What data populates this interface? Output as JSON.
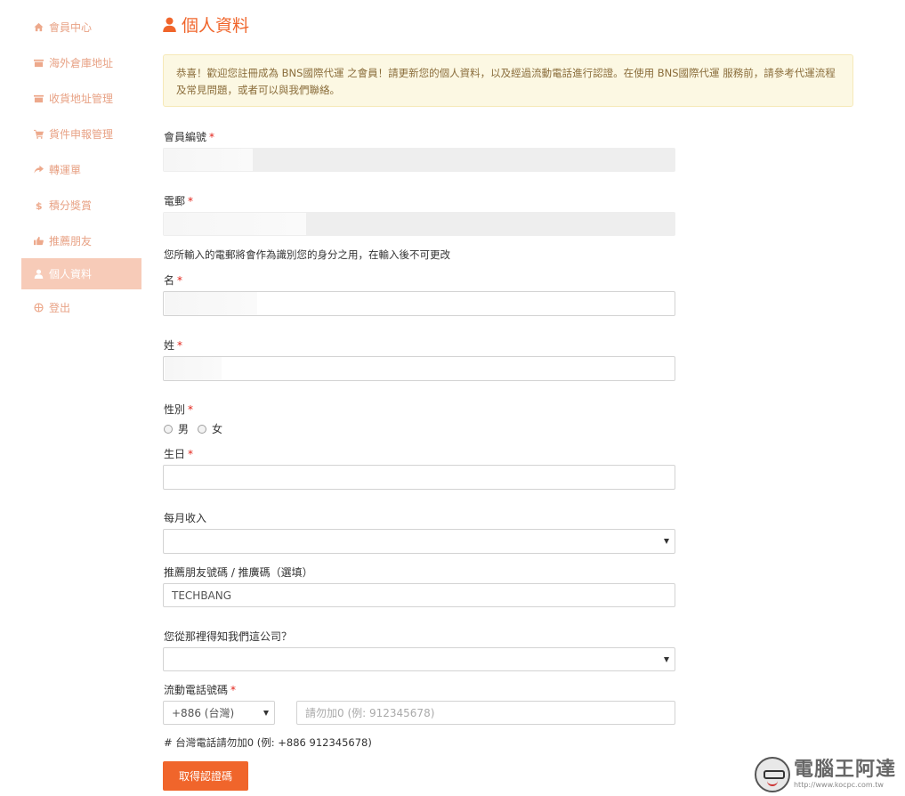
{
  "sidebar": {
    "items": [
      {
        "label": "會員中心",
        "icon": "home-icon"
      },
      {
        "label": "海外倉庫地址",
        "icon": "warehouse-icon"
      },
      {
        "label": "收貨地址管理",
        "icon": "address-icon"
      },
      {
        "label": "貨件申報管理",
        "icon": "cart-icon"
      },
      {
        "label": "轉運單",
        "icon": "share-arrow-icon"
      },
      {
        "label": "積分獎賞",
        "icon": "dollar-icon"
      },
      {
        "label": "推薦朋友",
        "icon": "thumbs-up-icon"
      },
      {
        "label": "個人資料",
        "icon": "user-icon",
        "active": true
      },
      {
        "label": "登出",
        "icon": "globe-icon"
      }
    ]
  },
  "page": {
    "title": "個人資料",
    "title_icon": "user-icon",
    "accent_color": "#f0652b"
  },
  "notice": {
    "text": "恭喜！歡迎您註冊成為 BNS國際代運 之會員！請更新您的個人資料，以及經過流動電話進行認證。在使用 BNS國際代運 服務前，請參考代運流程及常見問題，或者可以與我們聯絡。"
  },
  "form": {
    "member_no": {
      "label": "會員編號",
      "required": "*",
      "value": ""
    },
    "email": {
      "label": "電郵",
      "required": "*",
      "value": "",
      "help": "您所輸入的電郵將會作為識別您的身分之用，在輸入後不可更改"
    },
    "first_name": {
      "label": "名",
      "required": "*",
      "value": ""
    },
    "last_name": {
      "label": "姓",
      "required": "*",
      "value": ""
    },
    "gender": {
      "label": "性別",
      "required": "*",
      "options": [
        "男",
        "女"
      ]
    },
    "birthday": {
      "label": "生日",
      "required": "*",
      "value": ""
    },
    "income": {
      "label": "每月收入",
      "value": ""
    },
    "referral": {
      "label": "推薦朋友號碼 / 推廣碼（選填）",
      "value": "TECHBANG"
    },
    "source": {
      "label": "您從那裡得知我們這公司？",
      "value": ""
    },
    "mobile": {
      "label": "流動電話號碼",
      "required": "*",
      "country_code": "+886 (台灣)",
      "placeholder": "請勿加0 (例: 912345678)",
      "help": "# 台灣電話請勿加0 (例: +886 912345678)"
    },
    "submit_label": "取得認證碼"
  },
  "watermark": {
    "brand": "電腦王阿達",
    "url": "http://www.kocpc.com.tw"
  }
}
